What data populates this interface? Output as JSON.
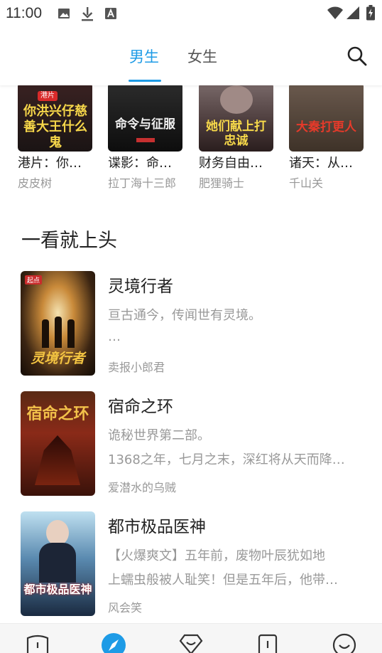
{
  "status_bar": {
    "time": "11:00"
  },
  "header": {
    "tabs": [
      {
        "label": "男生",
        "active": true
      },
      {
        "label": "女生",
        "active": false
      }
    ],
    "accent_color": "#1e9be6"
  },
  "grid_books": [
    {
      "title": "港片：你…",
      "author": "皮皮树",
      "cover_text": "你洪兴仔慈善大王什么鬼"
    },
    {
      "title": "谍影：命…",
      "author": "拉丁海十三郎",
      "cover_text": "命令与征服"
    },
    {
      "title": "财务自由…",
      "author": "肥狸骑士",
      "cover_text": "她们献上打忠诚"
    },
    {
      "title": "诸天：从…",
      "author": "千山关",
      "cover_text": "大秦打更人"
    }
  ],
  "section": {
    "title": "一看就上头"
  },
  "books": [
    {
      "title": "灵境行者",
      "lines": [
        "亘古通今，传闻世有灵境。",
        "…"
      ],
      "author": "卖报小郎君",
      "cover_text": "灵境行者"
    },
    {
      "title": "宿命之环",
      "lines": [
        "诡秘世界第二部。",
        "1368之年，七月之末，深红将从天而降…"
      ],
      "author": "爱潜水的乌贼",
      "cover_text": "宿命之环"
    },
    {
      "title": "都市极品医神",
      "lines": [
        "【火爆爽文】五年前，废物叶辰犹如地",
        "上蠕虫般被人耻笑！但是五年后，他带…"
      ],
      "author": "风会笑",
      "cover_text": "都市极品医神"
    }
  ],
  "bottom_nav": {
    "items": [
      {
        "icon": "bookshelf-icon",
        "active": false
      },
      {
        "icon": "compass-icon",
        "active": true
      },
      {
        "icon": "heart-icon",
        "active": false
      },
      {
        "icon": "bookmark-icon",
        "active": false
      },
      {
        "icon": "profile-icon",
        "active": false
      }
    ]
  }
}
